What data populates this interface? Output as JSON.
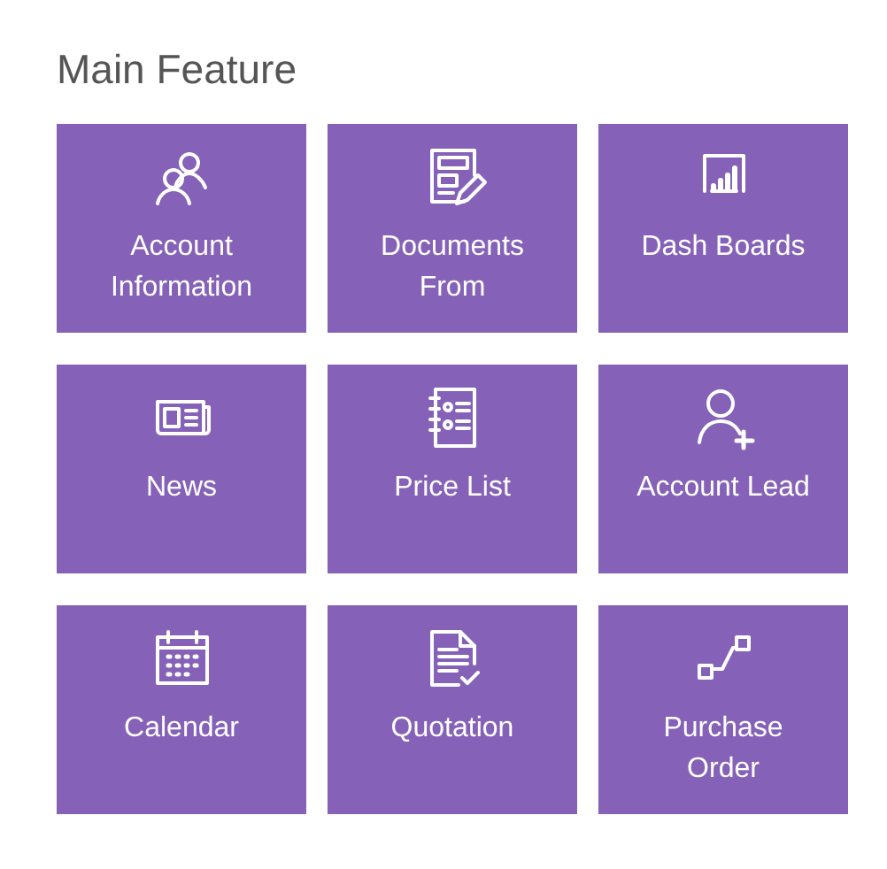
{
  "title": "Main Feature",
  "tiles": [
    {
      "label": "Account Information"
    },
    {
      "label": "Documents From"
    },
    {
      "label": "Dash Boards"
    },
    {
      "label": "News"
    },
    {
      "label": "Price List"
    },
    {
      "label": "Account Lead"
    },
    {
      "label": "Calendar"
    },
    {
      "label": "Quotation"
    },
    {
      "label": "Purchase Order"
    }
  ]
}
